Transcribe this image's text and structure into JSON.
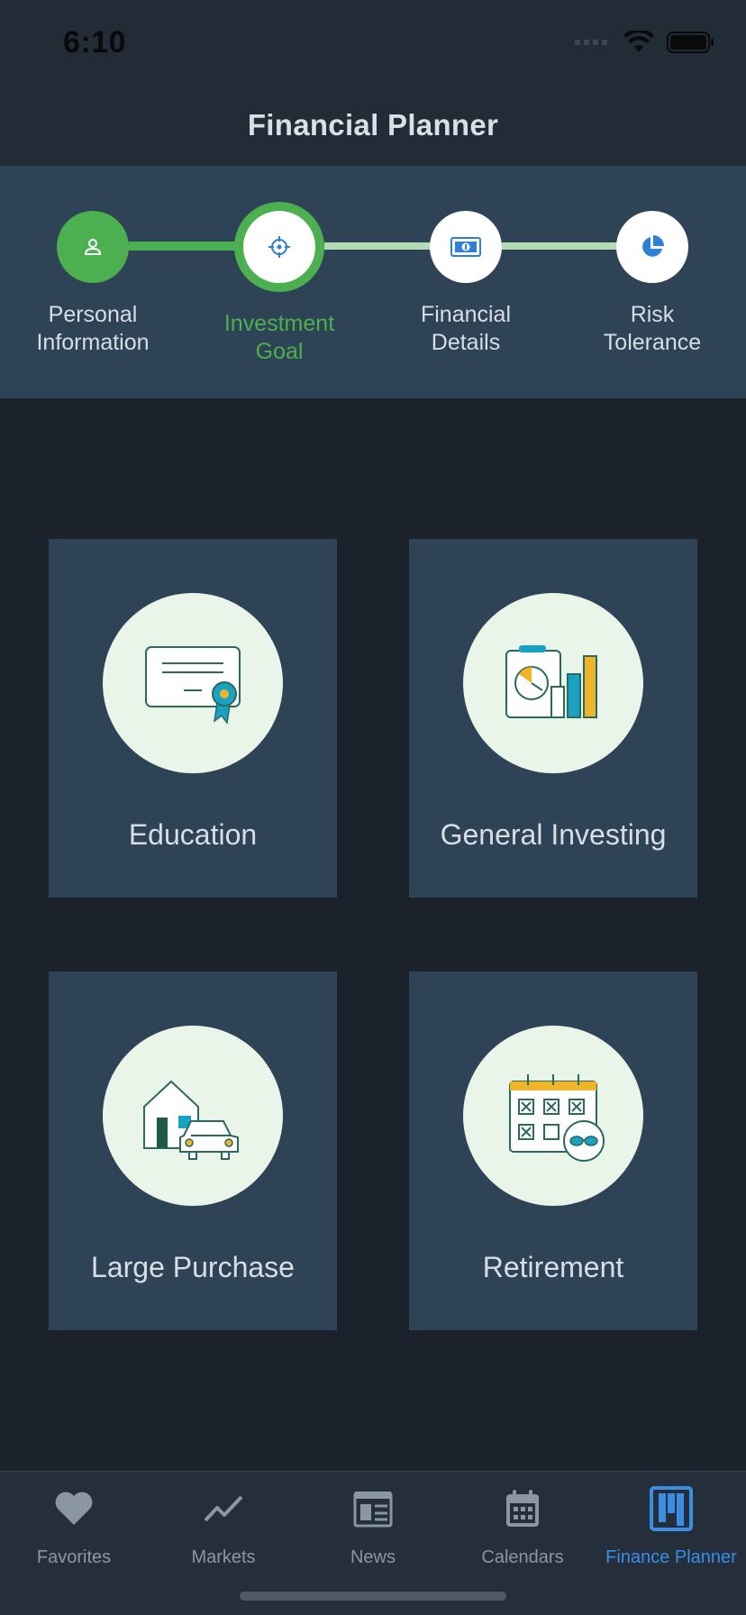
{
  "status": {
    "time": "6:10"
  },
  "header": {
    "title": "Financial Planner"
  },
  "stepper": {
    "steps": [
      {
        "label_line1": "Personal",
        "label_line2": "Information",
        "icon": "person-icon",
        "state": "done"
      },
      {
        "label_line1": "Investment",
        "label_line2": "Goal",
        "icon": "target-icon",
        "state": "active"
      },
      {
        "label_line1": "Financial",
        "label_line2": "Details",
        "icon": "money-icon",
        "state": "pending"
      },
      {
        "label_line1": "Risk",
        "label_line2": "Tolerance",
        "icon": "pie-icon",
        "state": "pending"
      }
    ]
  },
  "goals": [
    {
      "label": "Education",
      "icon": "certificate-icon"
    },
    {
      "label": "General Investing",
      "icon": "investing-chart-icon"
    },
    {
      "label": "Large Purchase",
      "icon": "house-car-icon"
    },
    {
      "label": "Retirement",
      "icon": "calendar-sunglasses-icon"
    }
  ],
  "tabs": [
    {
      "label": "Favorites",
      "icon": "heart-icon",
      "active": false
    },
    {
      "label": "Markets",
      "icon": "trend-line-icon",
      "active": false
    },
    {
      "label": "News",
      "icon": "newspaper-icon",
      "active": false
    },
    {
      "label": "Calendars",
      "icon": "calendar-icon",
      "active": false
    },
    {
      "label": "Finance Planner",
      "icon": "planner-board-icon",
      "active": true
    }
  ],
  "colors": {
    "accent_green": "#4caf50",
    "accent_blue": "#3a8ee6",
    "card_bg": "#2e4356",
    "page_bg": "#1b222b"
  }
}
